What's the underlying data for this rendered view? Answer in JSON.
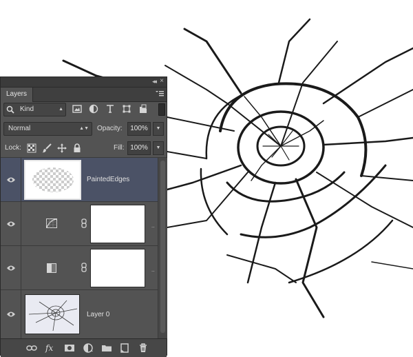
{
  "canvas": {
    "background_color": "#ffffff",
    "subject": "shattered-glass-cracks"
  },
  "panel": {
    "tab_label": "Layers",
    "filter": {
      "label": "Kind",
      "icons": [
        "image-filter-icon",
        "adjustment-filter-icon",
        "type-filter-icon",
        "shape-filter-icon",
        "smart-object-filter-icon"
      ]
    },
    "blend_mode": "Normal",
    "opacity_label": "Opacity:",
    "opacity_value": "100%",
    "lock_label": "Lock:",
    "fill_label": "Fill:",
    "fill_value": "100%",
    "layers": [
      {
        "name": "PaintedEdges",
        "visible": true,
        "selected": true,
        "thumbnail": "transparent-checkerboard-with-white-center"
      },
      {
        "name": "",
        "visible": true,
        "type": "curves-adjustment",
        "mask": "white"
      },
      {
        "name": "",
        "visible": true,
        "type": "levels-adjustment",
        "mask": "white"
      },
      {
        "name": "Layer 0",
        "visible": true,
        "thumbnail": "cracked-glass-photo"
      }
    ],
    "bottom_icons": [
      "link-layers-icon",
      "fx-icon",
      "add-mask-icon",
      "new-adjustment-icon",
      "new-group-icon",
      "new-layer-icon",
      "delete-layer-icon"
    ],
    "bottom_fx_label": "fx",
    "colors": {
      "panel": "#535353",
      "selected_row": "#4b5266",
      "text": "#e0e0e0"
    }
  }
}
